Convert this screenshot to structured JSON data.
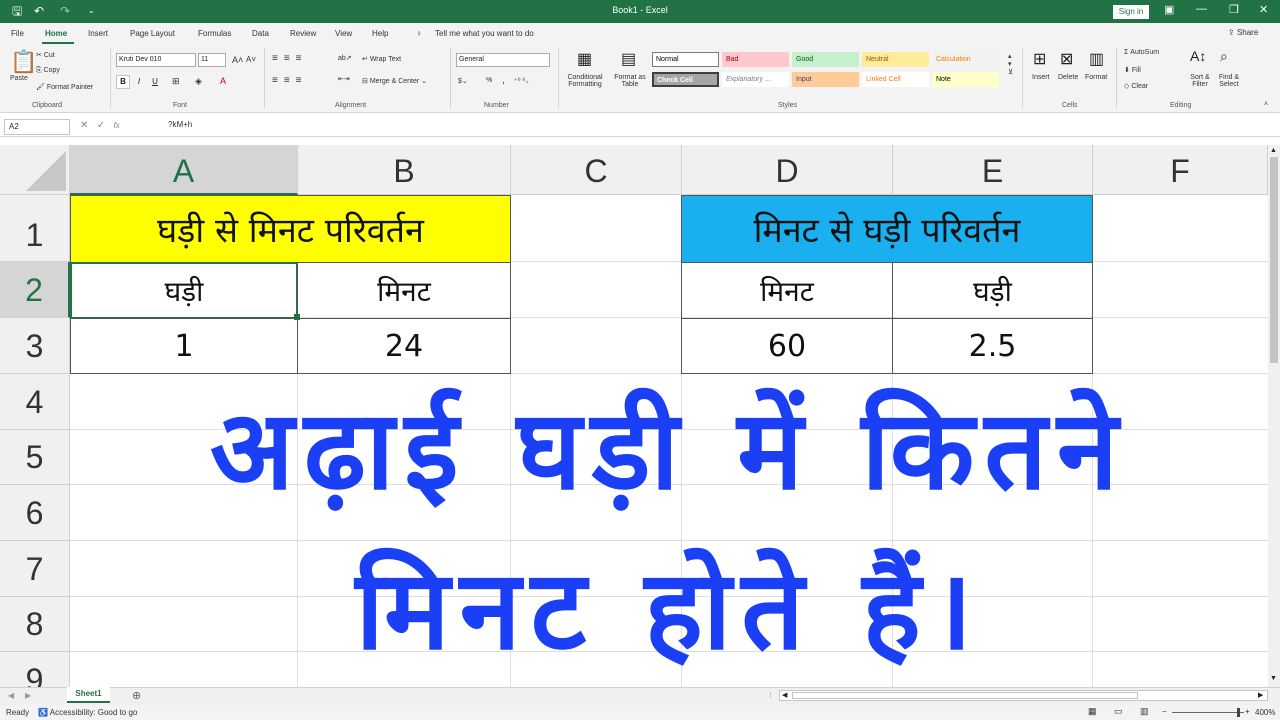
{
  "titlebar": {
    "title": "Book1  -  Excel",
    "signin": "Sign in"
  },
  "menu": {
    "items": [
      "File",
      "Home",
      "Insert",
      "Page Layout",
      "Formulas",
      "Data",
      "Review",
      "View",
      "Help"
    ],
    "tellme": "Tell me what you want to do",
    "share": "Share"
  },
  "ribbon": {
    "clipboard": {
      "paste": "Paste",
      "cut": "Cut",
      "copy": "Copy",
      "painter": "Format Painter",
      "label": "Clipboard"
    },
    "font": {
      "name": "Kruti Dev 010",
      "size": "11",
      "label": "Font",
      "bold": "B",
      "italic": "I",
      "underline": "U"
    },
    "alignment": {
      "wrap": "Wrap Text",
      "merge": "Merge & Center",
      "label": "Alignment"
    },
    "number": {
      "format": "General",
      "label": "Number",
      "pct": "%",
      "comma": ","
    },
    "styles": {
      "conditional": "Conditional Formatting",
      "format_table": "Format as Table",
      "label": "Styles",
      "cells": [
        {
          "name": "Normal",
          "bg": "#ffffff",
          "fg": "#000000"
        },
        {
          "name": "Bad",
          "bg": "#ffc7ce",
          "fg": "#9c0006"
        },
        {
          "name": "Good",
          "bg": "#c6efce",
          "fg": "#006100"
        },
        {
          "name": "Neutral",
          "bg": "#ffeb9c",
          "fg": "#9c5700"
        },
        {
          "name": "Calculation",
          "bg": "#f2f2f2",
          "fg": "#fa7d00"
        },
        {
          "name": "Check Cell",
          "bg": "#a5a5a5",
          "fg": "#ffffff"
        },
        {
          "name": "Explanatory ...",
          "bg": "#ffffff",
          "fg": "#7f7f7f"
        },
        {
          "name": "Input",
          "bg": "#ffcc99",
          "fg": "#3f3f76"
        },
        {
          "name": "Linked Cell",
          "bg": "#ffffff",
          "fg": "#fa7d00"
        },
        {
          "name": "Note",
          "bg": "#ffffcc",
          "fg": "#000000"
        }
      ]
    },
    "cells": {
      "insert": "Insert",
      "delete": "Delete",
      "format": "Format",
      "label": "Cells"
    },
    "editing": {
      "autosum": "AutoSum",
      "fill": "Fill",
      "clear": "Clear",
      "sort": "Sort & Filter",
      "find": "Find & Select",
      "label": "Editing"
    }
  },
  "formula_bar": {
    "name_box": "A2",
    "formula": "?kM+h"
  },
  "columns": [
    "A",
    "B",
    "C",
    "D",
    "E",
    "F"
  ],
  "rows": [
    "1",
    "2",
    "3",
    "4",
    "5",
    "6",
    "7",
    "8",
    "9"
  ],
  "sheet": {
    "left_title": "घड़ी से मिनट परिवर्तन",
    "right_title": "मिनट से घड़ी परिवर्तन",
    "a2": "घड़ी",
    "b2": "मिनट",
    "d2": "मिनट",
    "e2": "घड़ी",
    "a3": "1",
    "b3": "24",
    "d3": "60",
    "e3": "2.5",
    "big_line1": "अढ़ाई घड़ी में कितने",
    "big_line2": "मिनट होते हैं।",
    "colors": {
      "yellow": "#ffff00",
      "blue": "#1aafef",
      "bigtext": "#1a3ff5",
      "excel_green": "#217346"
    }
  },
  "tabs": {
    "sheet1": "Sheet1"
  },
  "status": {
    "ready": "Ready",
    "accessibility": "Accessibility: Good to go",
    "zoom": "400%"
  }
}
